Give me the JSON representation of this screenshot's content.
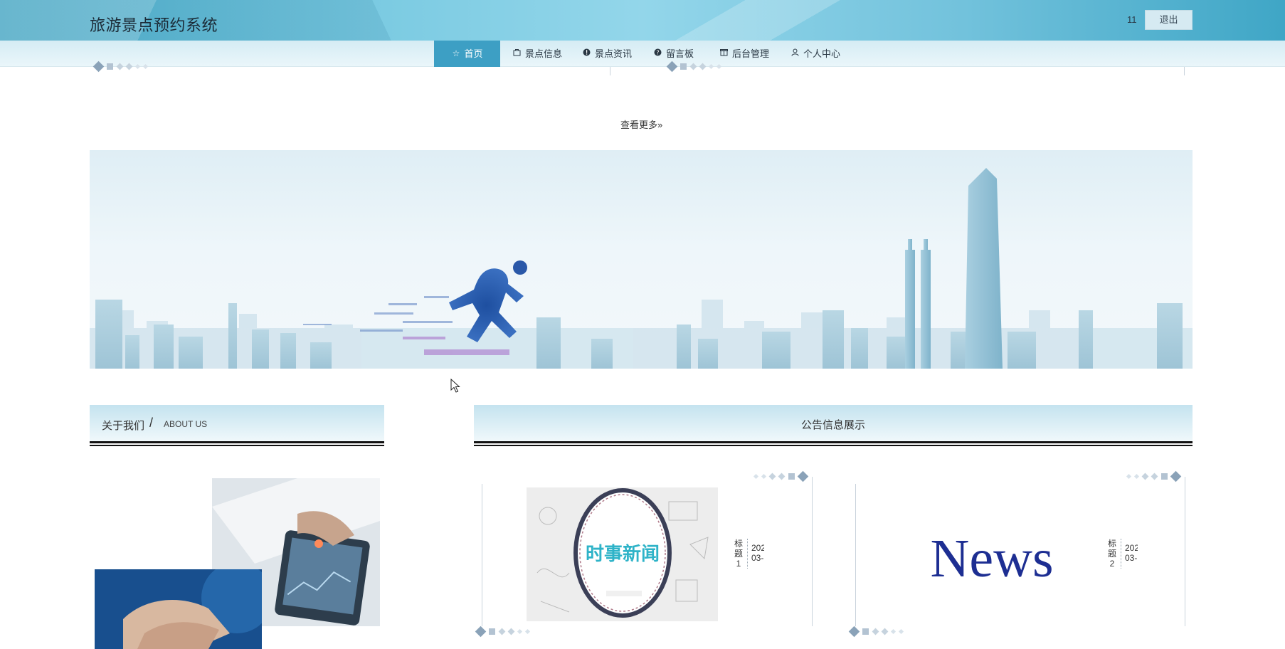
{
  "header": {
    "title": "旅游景点预约系统",
    "username": "11",
    "logout_label": "退出"
  },
  "nav": {
    "items": [
      {
        "label": "首页",
        "icon": "star-icon",
        "active": true
      },
      {
        "label": "景点信息",
        "icon": "bag-icon"
      },
      {
        "label": "景点资讯",
        "icon": "info-icon"
      },
      {
        "label": "留言板",
        "icon": "help-icon"
      },
      {
        "label": "后台管理",
        "icon": "box-icon"
      },
      {
        "label": "个人中心",
        "icon": "user-icon"
      }
    ]
  },
  "more_label": "查看更多»",
  "about": {
    "title_cn": "关于我们",
    "separator": "/",
    "title_en": "ABOUT US"
  },
  "notice": {
    "title": "公告信息展示",
    "items": [
      {
        "image_text": "时事新闻",
        "title_chars": [
          "标",
          "题",
          "1"
        ],
        "date_lines": [
          "202",
          "03-"
        ]
      },
      {
        "image_text": "News",
        "title_chars": [
          "标",
          "题",
          "2"
        ],
        "date_lines": [
          "202",
          "03-"
        ]
      }
    ]
  },
  "colors": {
    "accent": "#3d9fc4",
    "nav_bg": "#e1f1f7",
    "text": "#333333"
  }
}
